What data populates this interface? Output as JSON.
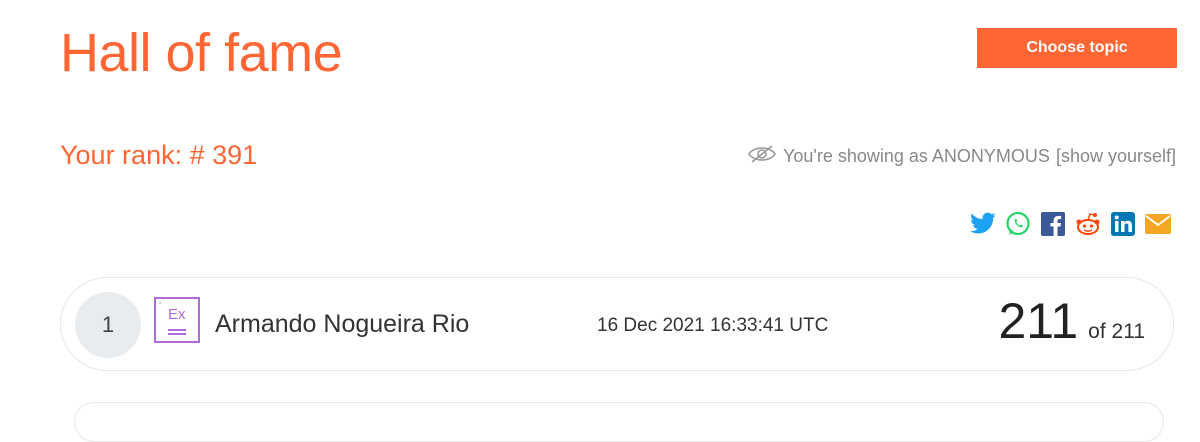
{
  "page": {
    "title": "Hall of fame"
  },
  "header": {
    "choose_topic_label": "Choose topic"
  },
  "rank": {
    "label": "Your rank: # 391"
  },
  "anonymity": {
    "status_text": "You're showing as ANONYMOUS",
    "show_link": "[show yourself]"
  },
  "share": {
    "icons": [
      "twitter-icon",
      "whatsapp-icon",
      "facebook-icon",
      "reddit-icon",
      "linkedin-icon",
      "email-icon"
    ],
    "colors": {
      "twitter": "#1da1f2",
      "whatsapp": "#25d366",
      "facebook": "#3b5998",
      "reddit": "#ff4500",
      "linkedin": "#0077b5",
      "email": "#f5a623"
    }
  },
  "leaderboard": {
    "rows": [
      {
        "rank": "1",
        "avatar_text": "Ex",
        "name": "Armando Nogueira Rio",
        "date": "16 Dec 2021 16:33:41 UTC",
        "score": "211",
        "total": "of 211"
      }
    ]
  },
  "colors": {
    "accent": "#ff6633",
    "muted": "#888888",
    "avatar": "#b06ad6"
  }
}
